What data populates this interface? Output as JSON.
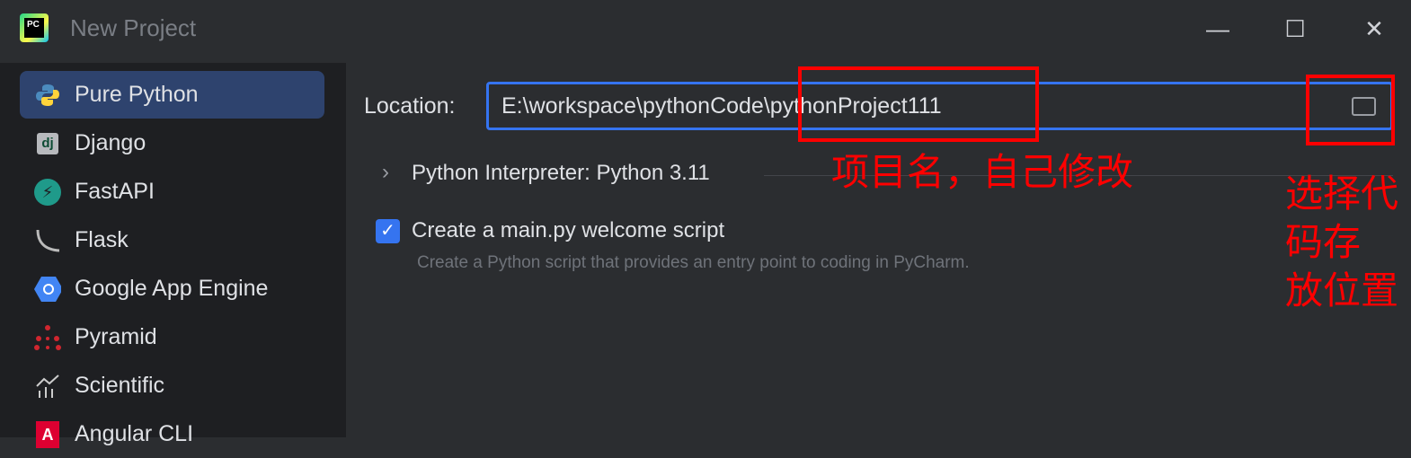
{
  "window": {
    "title": "New Project",
    "logo_text": "PC",
    "controls": {
      "minimize": "—",
      "maximize": "☐",
      "close": "✕"
    }
  },
  "sidebar": {
    "items": [
      {
        "label": "Pure Python",
        "icon": "python-icon",
        "selected": true
      },
      {
        "label": "Django",
        "icon": "django-icon"
      },
      {
        "label": "FastAPI",
        "icon": "fastapi-icon"
      },
      {
        "label": "Flask",
        "icon": "flask-icon"
      },
      {
        "label": "Google App Engine",
        "icon": "google-app-engine-icon"
      },
      {
        "label": "Pyramid",
        "icon": "pyramid-icon"
      },
      {
        "label": "Scientific",
        "icon": "scientific-icon"
      },
      {
        "label": "Angular CLI",
        "icon": "angular-icon"
      }
    ]
  },
  "main": {
    "location_label": "Location:",
    "location_value": "E:\\workspace\\pythonCode\\pythonProject111",
    "interpreter_label": "Python Interpreter: Python 3.11",
    "welcome_checkbox": {
      "label": "Create a main.py welcome script",
      "checked": true,
      "description": "Create a Python script that provides an entry point to coding in PyCharm."
    }
  },
  "annotations": {
    "project_name": "项目名，自己修改",
    "location_line1": "选择代",
    "location_line2": "码存",
    "location_line3": "放位置"
  },
  "colors": {
    "accent": "#3574f0",
    "annotation": "#ff0000",
    "selected": "#2e436e"
  }
}
